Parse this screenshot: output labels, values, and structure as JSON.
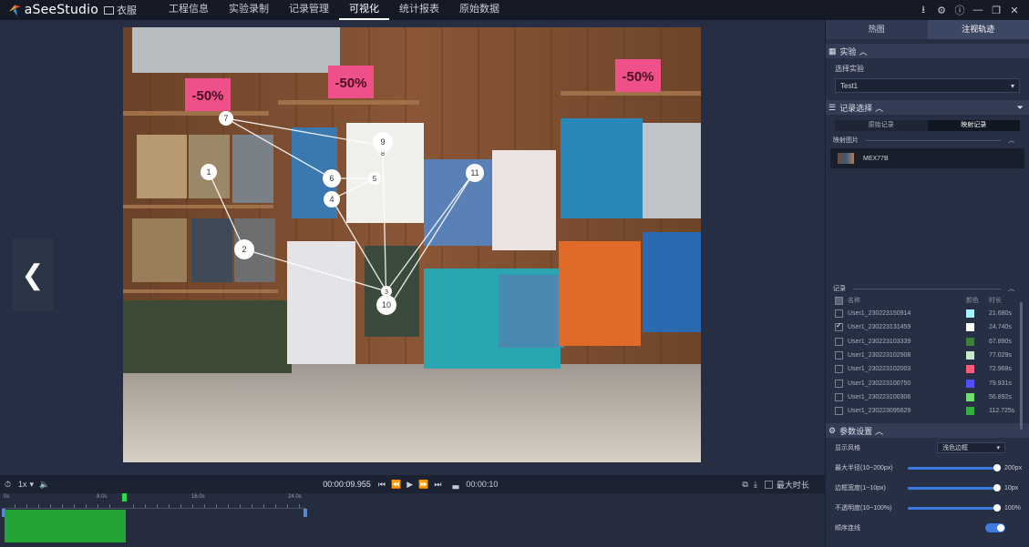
{
  "app": {
    "name": "aSeeStudio",
    "project": "衣服"
  },
  "nav": {
    "items": [
      "工程信息",
      "实验录制",
      "记录管理",
      "可视化",
      "统计报表",
      "原始数据"
    ],
    "active": "可视化"
  },
  "window_controls": [
    "download-icon",
    "gear-icon",
    "help-icon",
    "minimize-icon",
    "restore-icon",
    "close-icon"
  ],
  "stimulus": {
    "signs": [
      "-50%",
      "-50%",
      "-50%"
    ],
    "fixations": [
      "1",
      "2",
      "3",
      "4",
      "5",
      "6",
      "7",
      "8",
      "9",
      "10",
      "11"
    ]
  },
  "playback": {
    "speed": "1x",
    "current_time": "00:00:09.955",
    "duration": "00:00:10",
    "max_duration_label": "最大时长"
  },
  "timeline": {
    "ticks": [
      "0s",
      "8.0s",
      "16.0s",
      "24.0s"
    ]
  },
  "panel": {
    "tabs": [
      "热图",
      "注视轨迹"
    ],
    "active_tab": "注视轨迹",
    "experiment": {
      "title": "实验",
      "select_label": "选择实验",
      "value": "Test1"
    },
    "records_select": {
      "title": "记录选择",
      "modes": [
        "原始记录",
        "映射记录"
      ],
      "active_mode": "映射记录",
      "mapped_label": "映射图片",
      "mapped_item": "MEX77B"
    },
    "records": {
      "title": "记录",
      "columns": {
        "name": "名称",
        "color": "颜色",
        "duration": "时长"
      },
      "rows": [
        {
          "name": "User1_230223150914",
          "color": "#a8f0ff",
          "duration": "21.680s",
          "checked": false
        },
        {
          "name": "User1_230223131459",
          "color": "#ffffff",
          "duration": "24.740s",
          "checked": true
        },
        {
          "name": "User1_230223103339",
          "color": "#3e7f3e",
          "duration": "67.890s",
          "checked": false
        },
        {
          "name": "User1_230223102908",
          "color": "#c8e8d0",
          "duration": "77.029s",
          "checked": false
        },
        {
          "name": "User1_230223102003",
          "color": "#ff5a7a",
          "duration": "72.968s",
          "checked": false
        },
        {
          "name": "User1_230223100750",
          "color": "#5050ff",
          "duration": "79.931s",
          "checked": false
        },
        {
          "name": "User1_230223100306",
          "color": "#70e070",
          "duration": "56.892s",
          "checked": false
        },
        {
          "name": "User1_230223095629",
          "color": "#30b040",
          "duration": "112.725s",
          "checked": false
        }
      ]
    },
    "params": {
      "title": "参数设置",
      "style_label": "显示风格",
      "style_value": "浅色边框",
      "radius_label": "最大半径(10~200px)",
      "radius_value": "200px",
      "border_label": "边框宽度(1~10px)",
      "border_value": "10px",
      "opacity_label": "不透明度(10~100%)",
      "opacity_value": "100%",
      "connect_label": "顺序连线"
    }
  }
}
